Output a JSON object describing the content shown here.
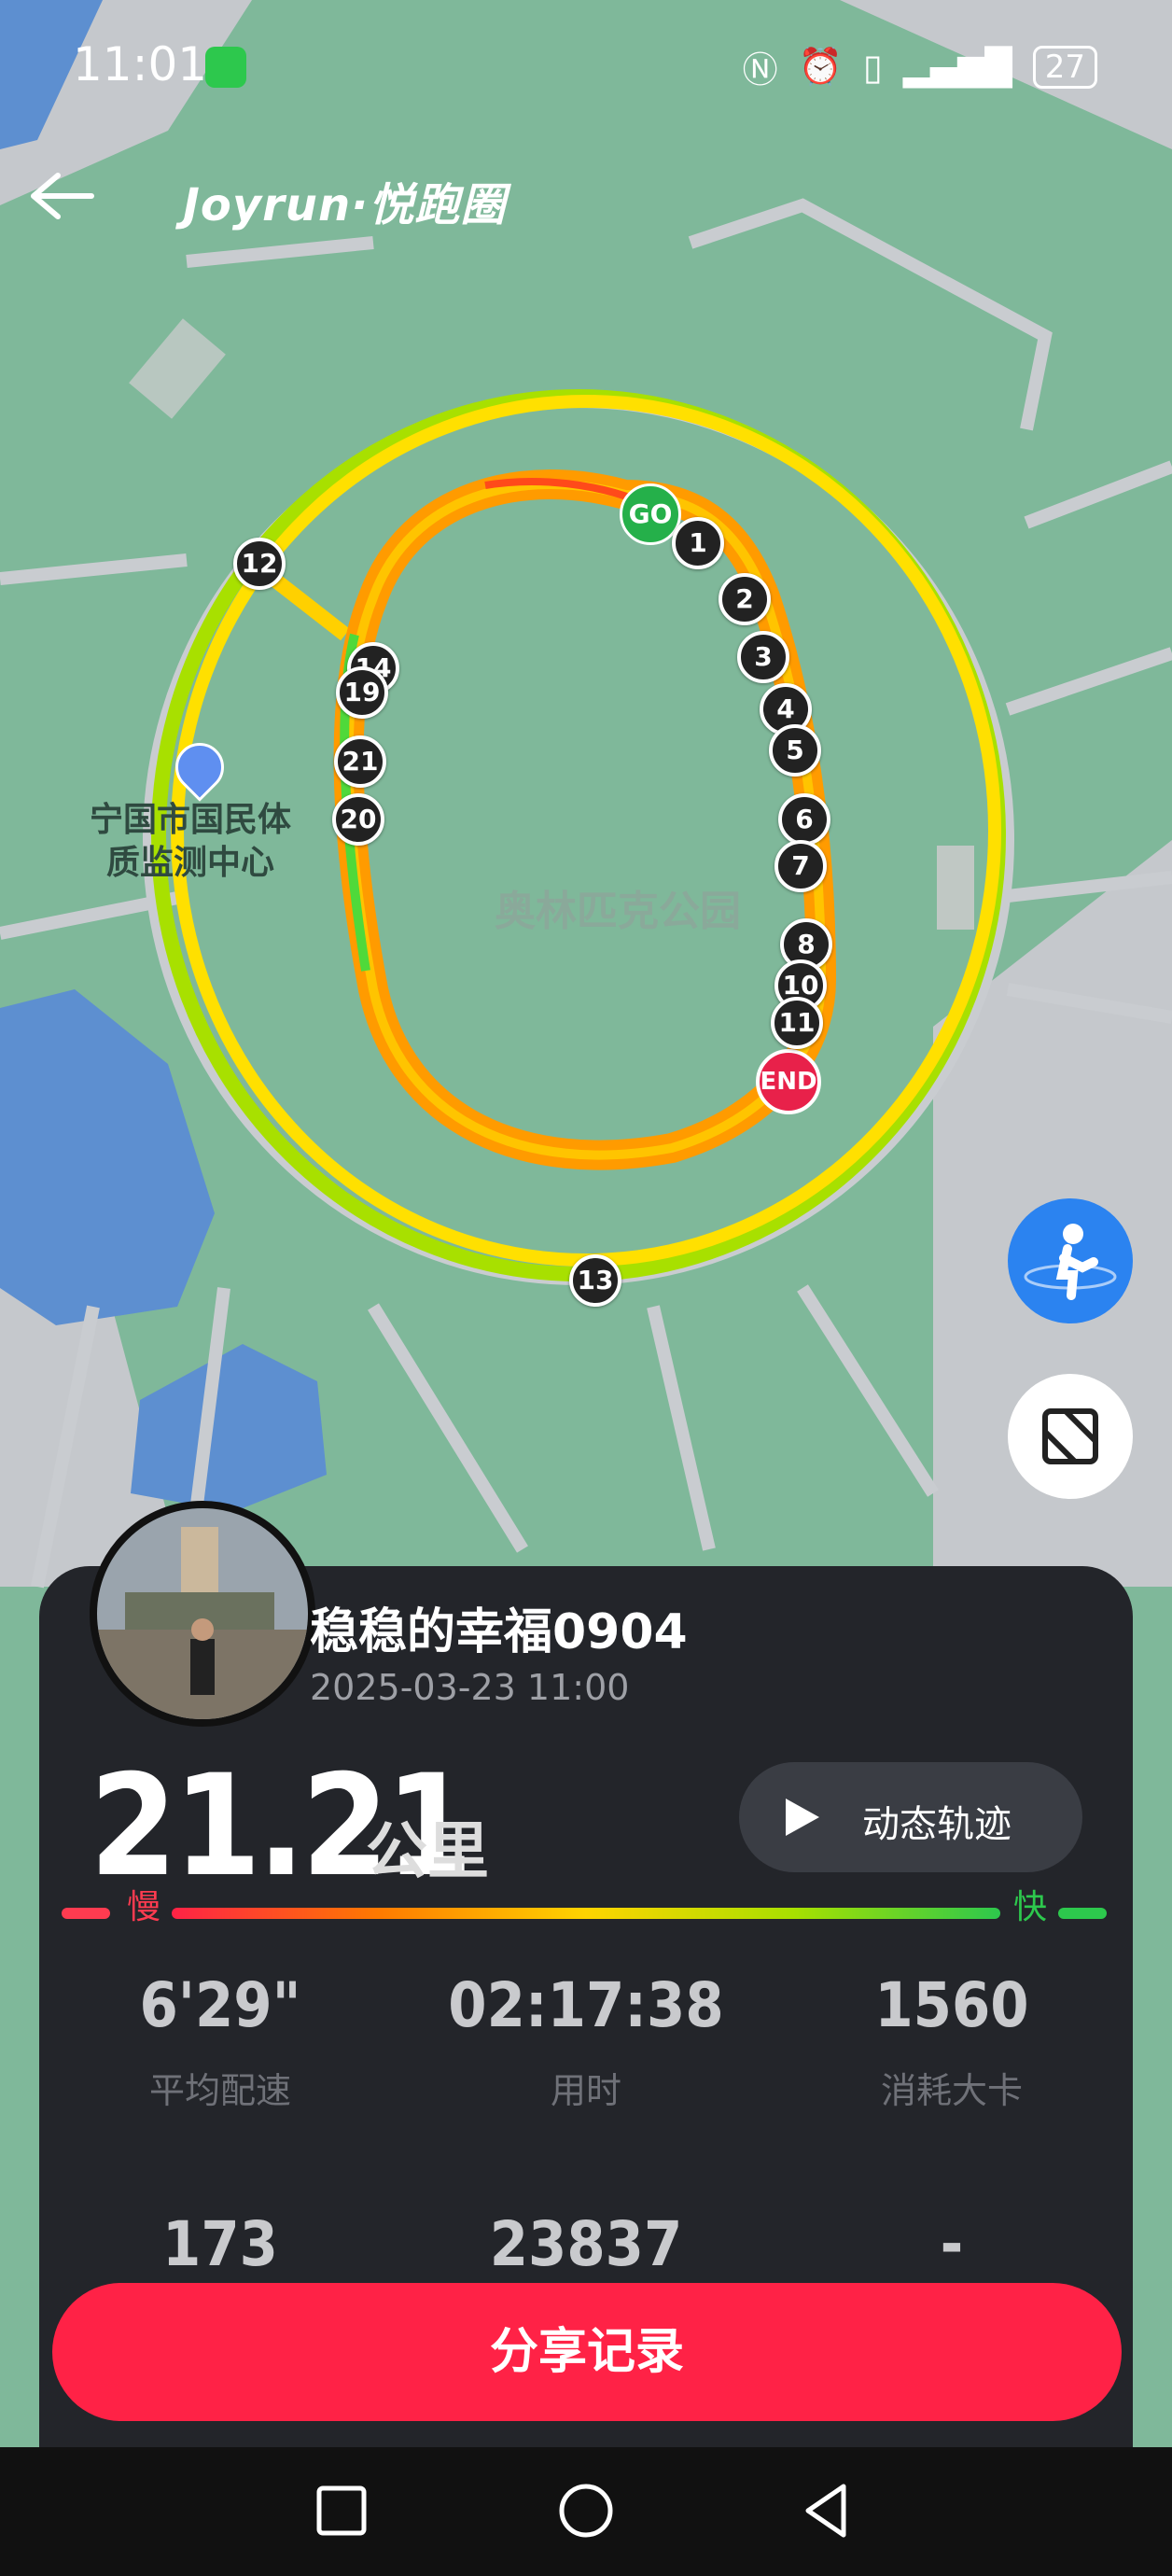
{
  "status_bar": {
    "time": "11:01",
    "battery": "27"
  },
  "header": {
    "brand": "Joyrun·悦跑圈"
  },
  "map": {
    "park_label": "奥林匹克公园",
    "poi_label_line1": "宁国市国民体",
    "poi_label_line2": "质监测中心",
    "start_label": "GO",
    "end_label": "END",
    "km_markers": [
      "1",
      "2",
      "3",
      "4",
      "5",
      "6",
      "7",
      "8",
      "10",
      "11",
      "12",
      "13",
      "14",
      "19",
      "21",
      "20"
    ]
  },
  "run": {
    "username": "稳稳的幸福0904",
    "datetime": "2025-03-23 11:00",
    "distance": "21.21",
    "distance_unit": "公里",
    "replay_label": "动态轨迹",
    "slow_label": "慢",
    "fast_label": "快",
    "stats": [
      {
        "value": "6'29\"",
        "label": "平均配速"
      },
      {
        "value": "02:17:38",
        "label": "用时"
      },
      {
        "value": "1560",
        "label": "消耗大卡"
      },
      {
        "value": "173",
        "label": ""
      },
      {
        "value": "23837",
        "label": ""
      },
      {
        "value": "-",
        "label": ""
      }
    ],
    "share_label": "分享记录"
  },
  "colors": {
    "accent": "#ff2246",
    "map_green": "#7fb89a",
    "card_bg": "#23252a",
    "start_green": "#25b04a",
    "end_red": "#e8214a",
    "fab_blue": "#2b83f0"
  }
}
